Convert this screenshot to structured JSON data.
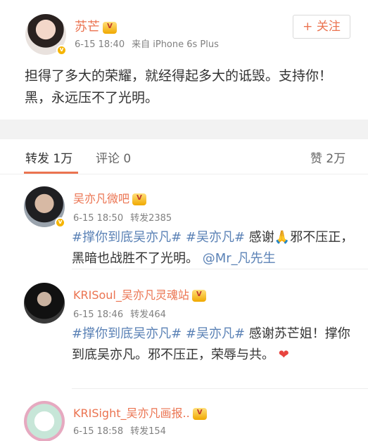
{
  "post": {
    "author": "苏芒",
    "time": "6-15 18:40",
    "source": "来自 iPhone 6s Plus",
    "follow_label": "+ 关注",
    "text": "担得了多大的荣耀，就经得起多大的诋毁。支持你！黑，永远压不了光明。"
  },
  "tabs": {
    "repost": "转发 1万",
    "comment": "评论 0",
    "like": "赞 2万"
  },
  "comments": [
    {
      "name": "吴亦凡微吧",
      "time": "6-15 18:50",
      "reposts": "转发2385",
      "tag1": "#撑你到底吴亦凡#",
      "tag2": "#吴亦凡#",
      "text": " 感谢🙏邪不压正，黑暗也战胜不了光明。",
      "mention": "@Mr_凡先生"
    },
    {
      "name": "KRISoul_吴亦凡灵魂站",
      "time": "6-15 18:46",
      "reposts": "转发464",
      "tag1": "#撑你到底吴亦凡#",
      "tag2": "#吴亦凡#",
      "text": " 感谢苏芒姐！撑你到底吴亦凡。邪不压正，荣辱与共。",
      "heart": "❤"
    },
    {
      "name": "KRISight_吴亦凡画报..",
      "time": "6-15 18:58",
      "reposts": "转发154"
    }
  ],
  "colors": {
    "accent": "#eb7350",
    "link": "#5b82b6",
    "verified": "#f5b400"
  }
}
